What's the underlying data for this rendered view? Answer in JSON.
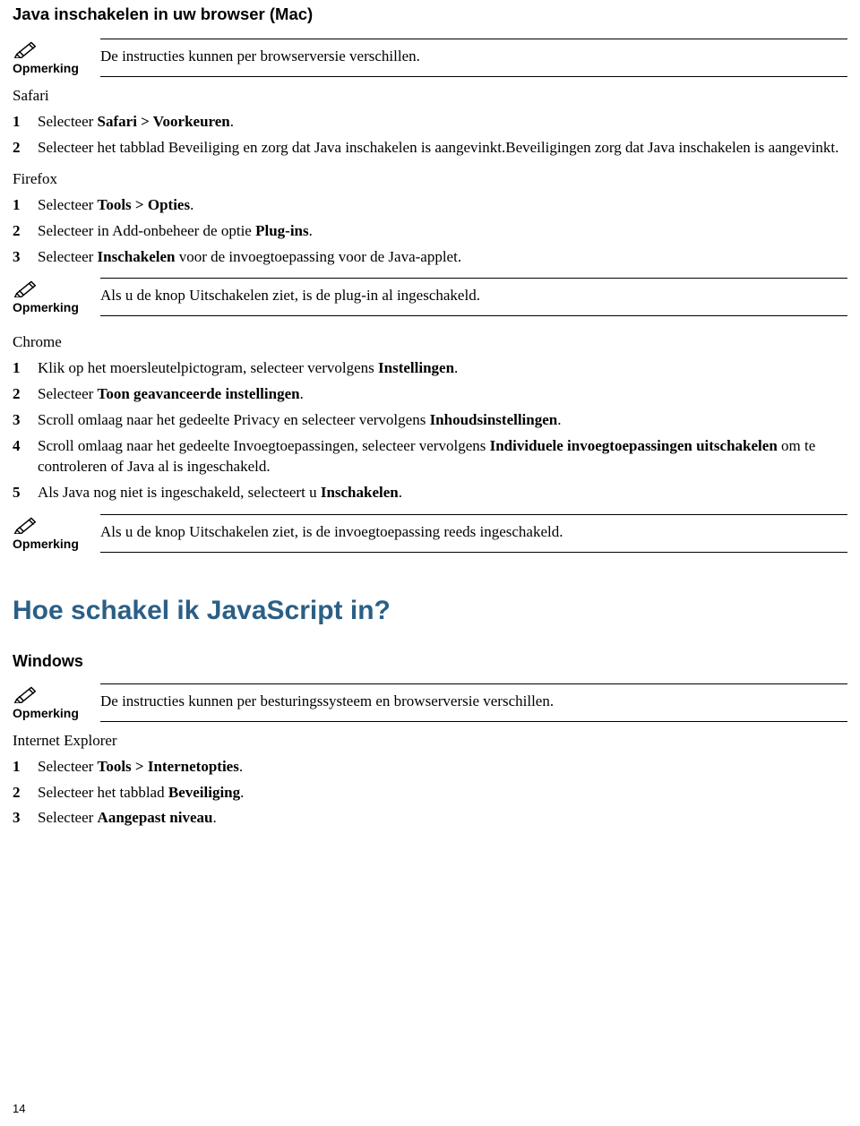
{
  "title_mac": "Java inschakelen in uw browser (Mac)",
  "opmerking_label": "Opmerking",
  "note1": "De instructies kunnen per browserversie verschillen.",
  "safari_head": "Safari",
  "safari_step1_a": "Selecteer ",
  "safari_step1_b": "Safari > Voorkeuren",
  "safari_step1_c": ".",
  "safari_step2": "Selecteer het tabblad Beveiliging en zorg dat Java inschakelen is aangevinkt.Beveiligingen zorg dat Java inschakelen is aangevinkt.",
  "firefox_head": "Firefox",
  "firefox_step1_a": "Selecteer ",
  "firefox_step1_b": "Tools > Opties",
  "firefox_step1_c": ".",
  "firefox_step2_a": "Selecteer in Add-onbeheer de optie ",
  "firefox_step2_b": "Plug-ins",
  "firefox_step2_c": ".",
  "firefox_step3_a": "Selecteer ",
  "firefox_step3_b": "Inschakelen",
  "firefox_step3_c": " voor de invoegtoepassing voor de Java-applet.",
  "note2": "Als u de knop Uitschakelen ziet, is de plug-in al ingeschakeld.",
  "chrome_head": "Chrome",
  "chrome_step1_a": "Klik op het moersleutelpictogram, selecteer vervolgens ",
  "chrome_step1_b": "Instellingen",
  "chrome_step1_c": ".",
  "chrome_step2_a": "Selecteer ",
  "chrome_step2_b": "Toon geavanceerde instellingen",
  "chrome_step2_c": ".",
  "chrome_step3_a": "Scroll omlaag naar het gedeelte Privacy en selecteer vervolgens ",
  "chrome_step3_b": "Inhoudsinstellingen",
  "chrome_step3_c": ".",
  "chrome_step4_a": "Scroll omlaag naar het gedeelte Invoegtoepassingen, selecteer vervolgens ",
  "chrome_step4_b": "Individuele invoegtoepassingen uitschakelen",
  "chrome_step4_c": " om te controleren of Java al is ingeschakeld.",
  "chrome_step5_a": "Als Java nog niet is ingeschakeld, selecteert u ",
  "chrome_step5_b": "Inschakelen",
  "chrome_step5_c": ".",
  "note3": "Als u de knop Uitschakelen ziet, is de invoegtoepassing reeds ingeschakeld.",
  "title_js": "Hoe schakel ik JavaScript in?",
  "windows_head": "Windows",
  "note4": "De instructies kunnen per besturingssysteem en browserversie verschillen.",
  "ie_head": "Internet Explorer",
  "ie_step1_a": "Selecteer ",
  "ie_step1_b": "Tools > Internetopties",
  "ie_step1_c": ".",
  "ie_step2_a": "Selecteer het tabblad ",
  "ie_step2_b": "Beveiliging",
  "ie_step2_c": ".",
  "ie_step3_a": "Selecteer ",
  "ie_step3_b": "Aangepast niveau",
  "ie_step3_c": ".",
  "page_number": "14"
}
